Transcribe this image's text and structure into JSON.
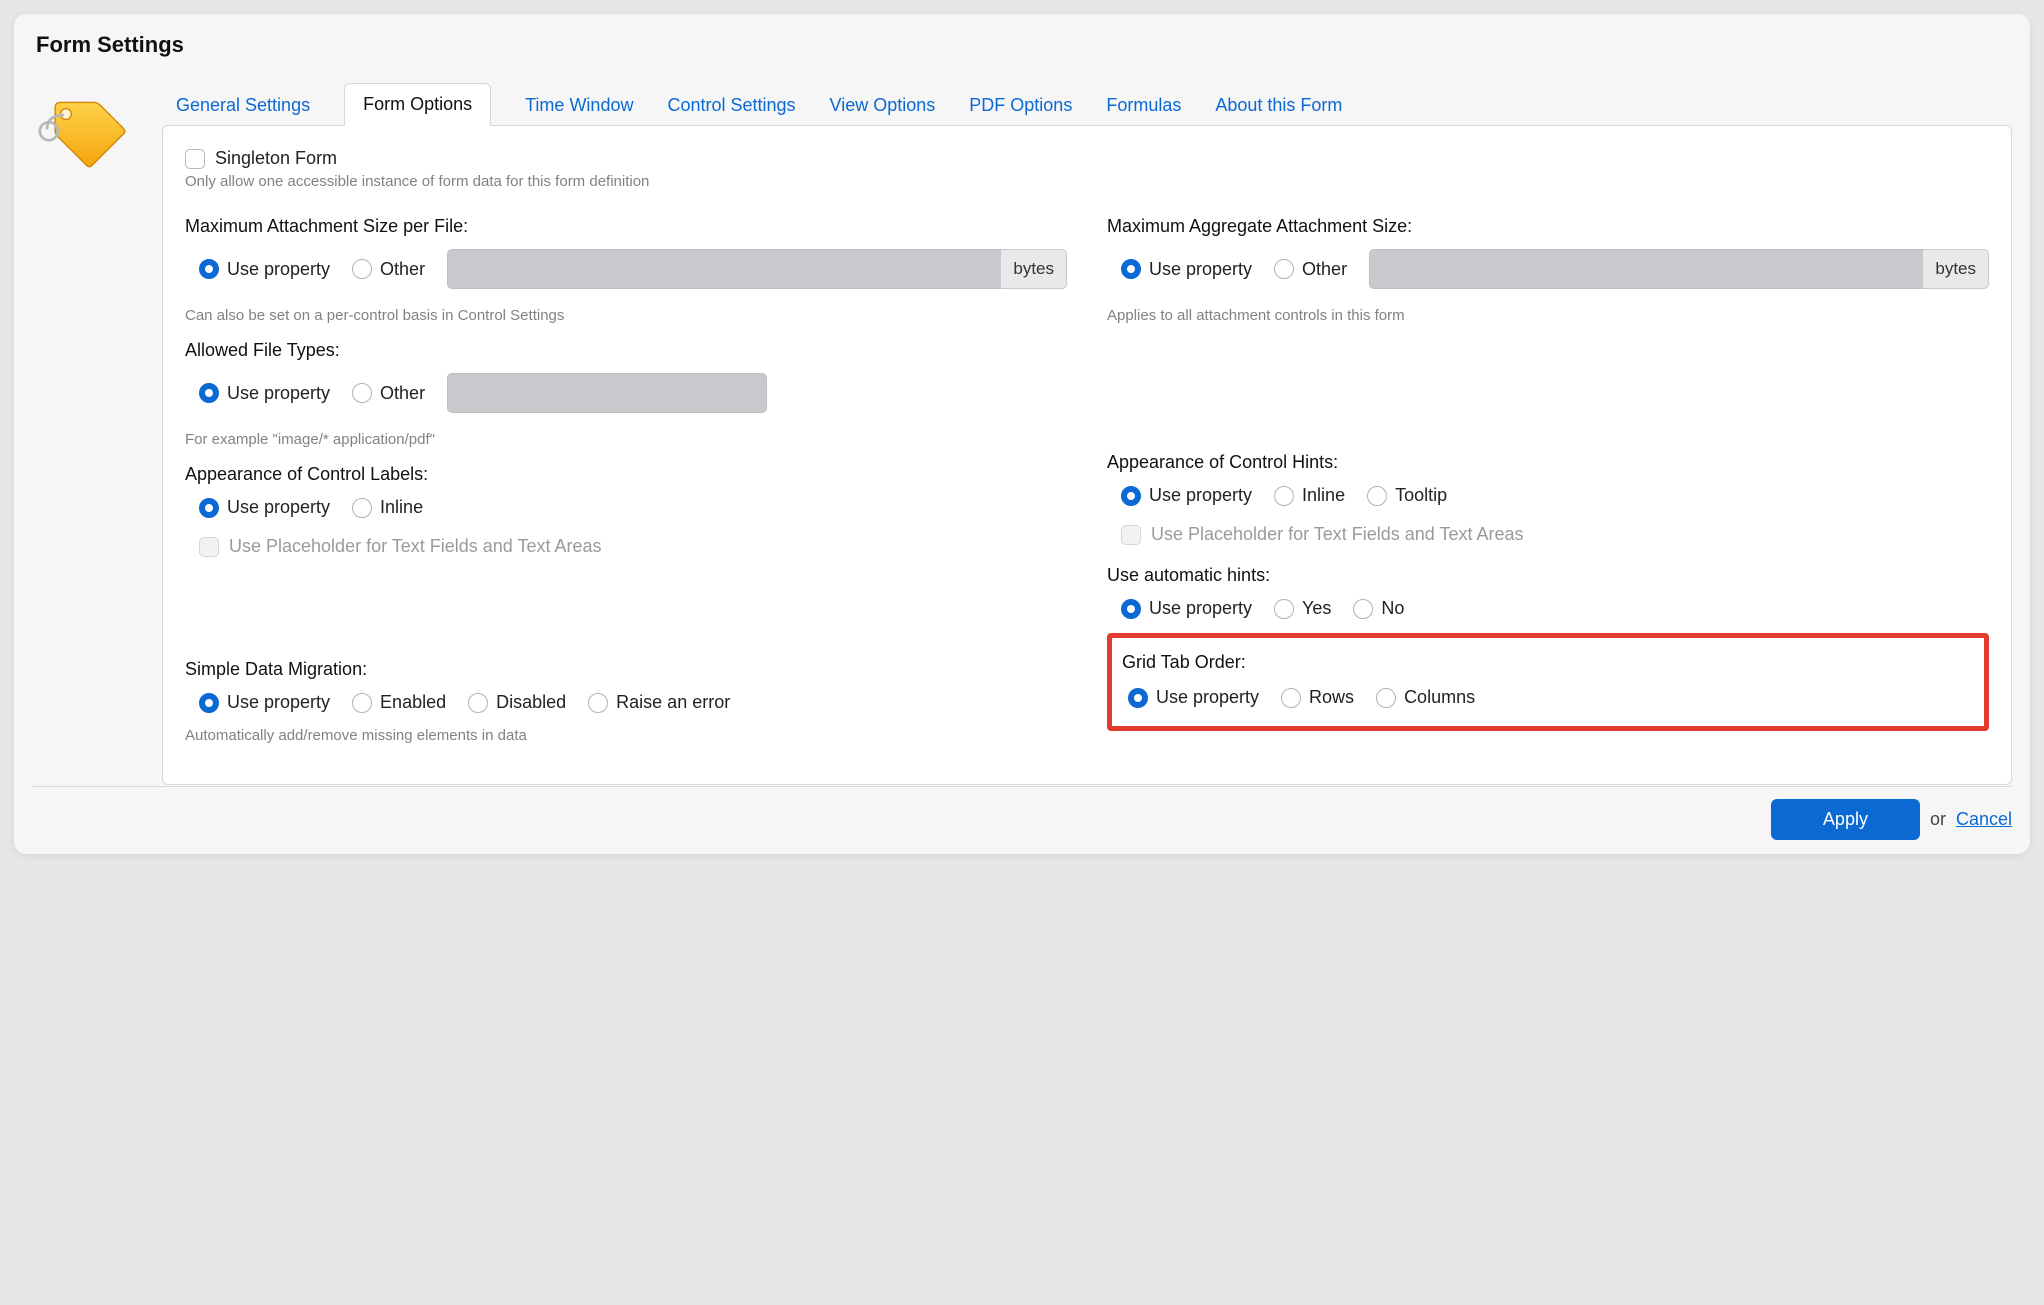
{
  "dialog": {
    "title": "Form Settings"
  },
  "tabs": [
    {
      "label": "General Settings"
    },
    {
      "label": "Form Options"
    },
    {
      "label": "Time Window"
    },
    {
      "label": "Control Settings"
    },
    {
      "label": "View Options"
    },
    {
      "label": "PDF Options"
    },
    {
      "label": "Formulas"
    },
    {
      "label": "About this Form"
    }
  ],
  "active_tab_index": 1,
  "singleton": {
    "label": "Singleton Form",
    "hint": "Only allow one accessible instance of form data for this form definition"
  },
  "max_attach_per_file": {
    "label": "Maximum Attachment Size per File:",
    "options": {
      "use_property": "Use property",
      "other": "Other"
    },
    "unit": "bytes",
    "hint": "Can also be set on a per-control basis in Control Settings"
  },
  "max_attach_aggregate": {
    "label": "Maximum Aggregate Attachment Size:",
    "options": {
      "use_property": "Use property",
      "other": "Other"
    },
    "unit": "bytes",
    "hint": "Applies to all attachment controls in this form"
  },
  "allowed_file_types": {
    "label": "Allowed File Types:",
    "options": {
      "use_property": "Use property",
      "other": "Other"
    },
    "hint": "For example \"image/* application/pdf\""
  },
  "control_labels": {
    "label": "Appearance of Control Labels:",
    "options": {
      "use_property": "Use property",
      "inline": "Inline"
    },
    "placeholder_chk": "Use Placeholder for Text Fields and Text Areas"
  },
  "control_hints": {
    "label": "Appearance of Control Hints:",
    "options": {
      "use_property": "Use property",
      "inline": "Inline",
      "tooltip": "Tooltip"
    },
    "placeholder_chk": "Use Placeholder for Text Fields and Text Areas"
  },
  "auto_hints": {
    "label": "Use automatic hints:",
    "options": {
      "use_property": "Use property",
      "yes": "Yes",
      "no": "No"
    }
  },
  "simple_data_migration": {
    "label": "Simple Data Migration:",
    "options": {
      "use_property": "Use property",
      "enabled": "Enabled",
      "disabled": "Disabled",
      "raise": "Raise an error"
    },
    "hint": "Automatically add/remove missing elements in data"
  },
  "grid_tab_order": {
    "label": "Grid Tab Order:",
    "options": {
      "use_property": "Use property",
      "rows": "Rows",
      "columns": "Columns"
    }
  },
  "footer": {
    "apply": "Apply",
    "or": "or",
    "cancel": "Cancel"
  }
}
